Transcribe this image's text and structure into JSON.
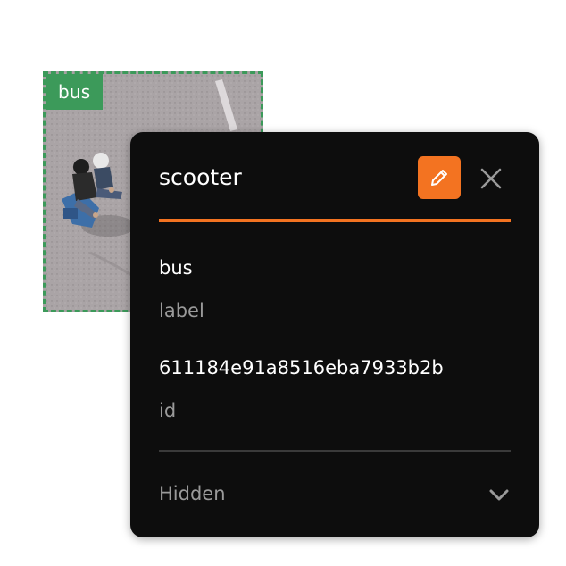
{
  "bbox": {
    "tag_label": "bus",
    "color": "#3c9a5a"
  },
  "panel": {
    "title": "scooter",
    "accent_color": "#f37321",
    "edit_icon": "pencil-icon",
    "close_icon": "close-icon",
    "fields": [
      {
        "value": "bus",
        "key": "label"
      },
      {
        "value": "611184e91a8516eba7933b2b",
        "key": "id"
      }
    ],
    "hidden_section": {
      "label": "Hidden",
      "icon": "chevron-down-icon"
    }
  }
}
